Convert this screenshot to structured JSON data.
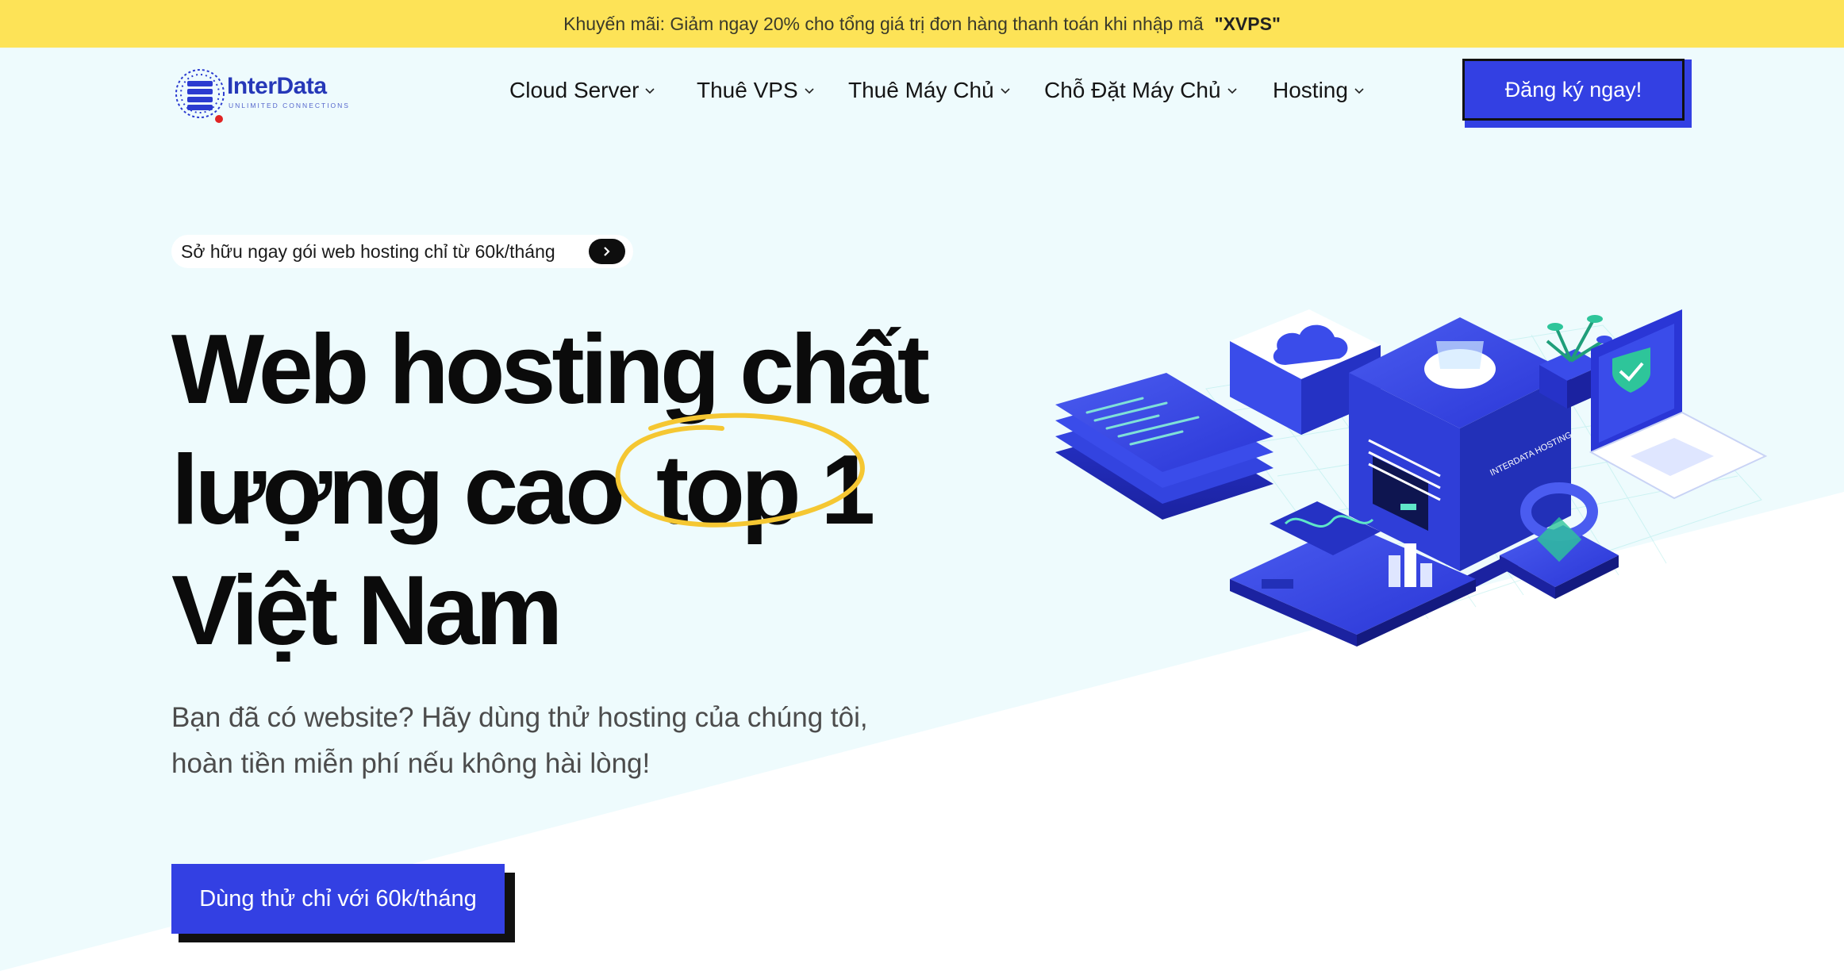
{
  "promo": {
    "text": "Khuyến mãi: Giảm ngay 20% cho tổng giá trị đơn hàng thanh toán khi nhập mã",
    "code": "\"XVPS\""
  },
  "brand": {
    "name_main": "InterData",
    "tagline": "UNLIMITED CONNECTIONS",
    "colors": {
      "primary": "#3340e3",
      "promo": "#fde357",
      "hero_bg": "#eefbfd"
    }
  },
  "nav": {
    "items": [
      {
        "label": "Cloud Server"
      },
      {
        "label": "Thuê VPS"
      },
      {
        "label": "Thuê Máy Chủ"
      },
      {
        "label": "Chỗ Đặt Máy Chủ"
      },
      {
        "label": "Hosting"
      }
    ],
    "cta": "Đăng ký ngay!"
  },
  "hero": {
    "pill_text": "Sở hữu ngay gói web hosting chỉ từ 60k/tháng",
    "headline_line1": "Web hosting chất",
    "headline_line2a": "lượng cao",
    "headline_line2b": "top 1",
    "headline_line3": "Việt Nam",
    "subtext": "Bạn đã có website? Hãy dùng thử hosting của chúng tôi, hoàn tiền miễn phí nếu không hài lòng!",
    "cta": "Dùng thử chỉ với 60k/tháng",
    "illustration_label": "INTERDATA HOSTING"
  }
}
